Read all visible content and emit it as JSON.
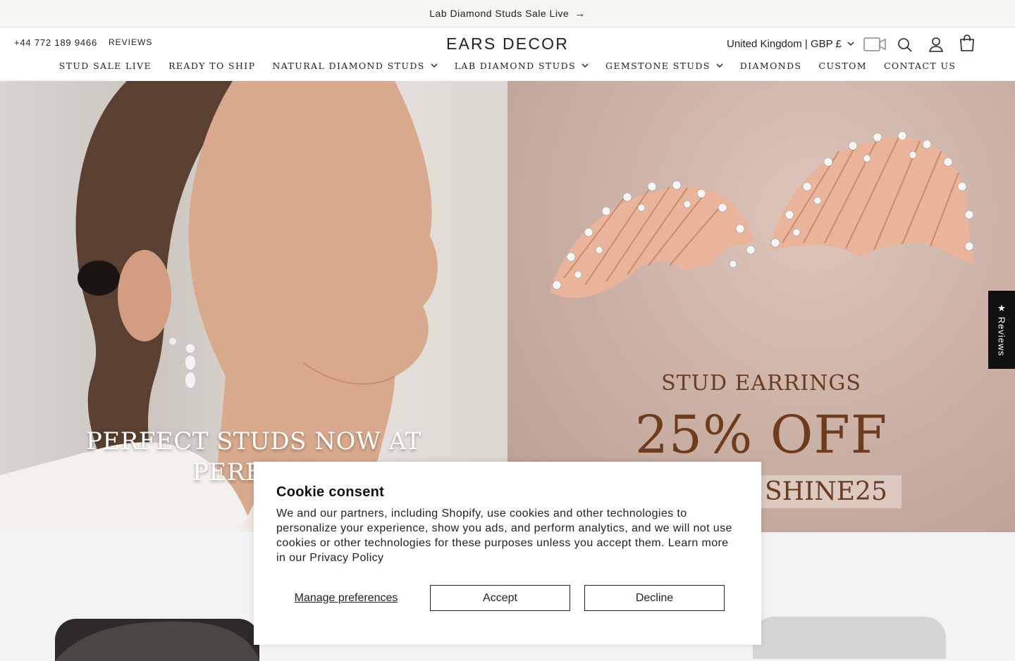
{
  "announcement": {
    "text": "Lab Diamond Studs Sale Live",
    "arrow": "→"
  },
  "header": {
    "phone": "+44 772 189 9466",
    "reviews_link": "REVIEWS",
    "logo": "EARS DECOR",
    "country_selector": "United Kingdom | GBP £",
    "icons": [
      "video-icon",
      "search-icon",
      "account-icon",
      "cart-icon"
    ]
  },
  "nav": {
    "items": [
      {
        "label": "STUD SALE LIVE",
        "dropdown": false
      },
      {
        "label": "READY TO SHIP",
        "dropdown": false
      },
      {
        "label": "NATURAL DIAMOND STUDS",
        "dropdown": true
      },
      {
        "label": "LAB DIAMOND STUDS",
        "dropdown": true
      },
      {
        "label": "GEMSTONE STUDS",
        "dropdown": true
      },
      {
        "label": "DIAMONDS",
        "dropdown": false
      },
      {
        "label": "CUSTOM",
        "dropdown": false
      },
      {
        "label": "CONTACT US",
        "dropdown": false
      }
    ]
  },
  "hero": {
    "left_text_line1": "PERFECT STUDS NOW AT",
    "left_text_line2": "PERFECT",
    "promo_line1": "STUD EARRINGS",
    "promo_line2": "25% OFF",
    "promo_code": "SHINE25"
  },
  "reviews_tab": {
    "star": "★",
    "label": "Reviews"
  },
  "cookie": {
    "title": "Cookie consent",
    "body": "We and our partners, including Shopify, use cookies and other technologies to personalize your experience, show you ads, and perform analytics, and we will not use cookies or other technologies for these purposes unless you accept them. Learn more in our Privacy Policy",
    "manage_label": "Manage preferences",
    "accept_label": "Accept",
    "decline_label": "Decline"
  },
  "colors": {
    "announcement_bg": "#f7f6f3",
    "promo_brown": "#6e3b1c",
    "hero_right_bg": "#c9aea3",
    "reviews_tab_bg": "#111111"
  }
}
